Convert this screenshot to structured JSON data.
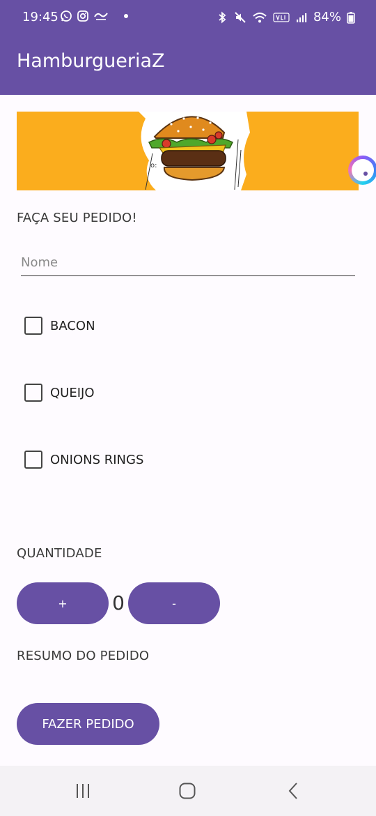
{
  "status_bar": {
    "time": "19:45",
    "battery": "84%",
    "left_icons": [
      "whatsapp-icon",
      "instagram-icon",
      "ifood-icon",
      "dot-icon"
    ],
    "right_icons": [
      "bluetooth-icon",
      "mute-icon",
      "wifi-icon",
      "volte-icon",
      "signal-icon",
      "battery-icon"
    ]
  },
  "app_bar": {
    "title": "HamburgueriaZ"
  },
  "colors": {
    "primary": "#6750a4",
    "banner": "#fbad1d",
    "background": "#fefbff"
  },
  "order": {
    "heading": "FAÇA SEU PEDIDO!",
    "name_placeholder": "Nome",
    "name_value": ""
  },
  "toppings": [
    {
      "label": "BACON",
      "checked": false
    },
    {
      "label": "QUEIJO",
      "checked": false
    },
    {
      "label": "ONIONS RINGS",
      "checked": false
    }
  ],
  "quantity": {
    "heading": "QUANTIDADE",
    "plus_label": "+",
    "minus_label": "-",
    "value": "0"
  },
  "summary": {
    "heading": "RESUMO DO PEDIDO"
  },
  "submit": {
    "label": "FAZER PEDIDO"
  },
  "navigation": [
    "recent-apps-icon",
    "home-icon",
    "back-icon"
  ]
}
